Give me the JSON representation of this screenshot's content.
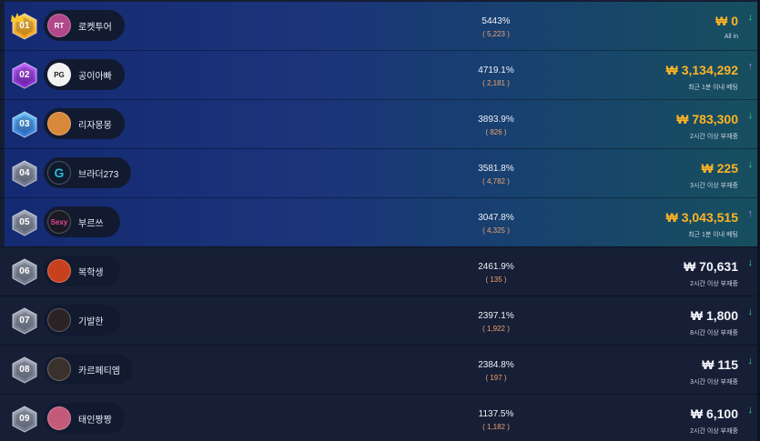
{
  "colors": {
    "gold_amount": "#ffb424",
    "white_amount": "#f3f5fa",
    "count_orange": "#f0a36f",
    "arrow_up": "#c47ce8",
    "arrow_down": "#3ad68a",
    "rank_gold": "#f5a623",
    "rank_purple": "#9b3fd6",
    "rank_blue": "#3f8ee8",
    "rank_gray": "#8a94a8"
  },
  "rows": [
    {
      "rank": "01",
      "name": "로켓투어",
      "percent": "5443%",
      "count": "( 5,223 )",
      "amount": "₩ 0",
      "status": "All in",
      "trend": "↓",
      "trend_dir": "down",
      "rank_color": "gold",
      "highlight": true,
      "avatar_icon": "rocket-tour-avatar-icon",
      "avatar_text": "RT",
      "avatar_color": "#b0488a"
    },
    {
      "rank": "02",
      "name": "공이아빠",
      "percent": "4719.1%",
      "count": "( 2,181 )",
      "amount": "₩ 3,134,292",
      "status": "최근 1분 이내 베팅",
      "trend": "↑",
      "trend_dir": "up",
      "rank_color": "purple",
      "highlight": true,
      "avatar_icon": "pg-logo-icon",
      "avatar_text": "PG",
      "avatar_color": "#f2f2f2"
    },
    {
      "rank": "03",
      "name": "리자몽몽",
      "percent": "3893.9%",
      "count": "( 826 )",
      "amount": "₩ 783,300",
      "status": "2시간 이상 부재중",
      "trend": "↓",
      "trend_dir": "down",
      "rank_color": "blue",
      "highlight": true,
      "avatar_icon": "game-avatar-icon",
      "avatar_text": "",
      "avatar_color": "#d9893a"
    },
    {
      "rank": "04",
      "name": "브라더273",
      "percent": "3581.8%",
      "count": "( 4,782 )",
      "amount": "₩ 225",
      "status": "3시간 이상 부재중",
      "trend": "↓",
      "trend_dir": "down",
      "rank_color": "gray",
      "highlight": true,
      "avatar_icon": "g-logo-icon",
      "avatar_text": "G",
      "avatar_color": "#0f1a2c"
    },
    {
      "rank": "05",
      "name": "부르쓰",
      "percent": "3047.8%",
      "count": "( 4,325 )",
      "amount": "₩ 3,043,515",
      "status": "최근 1분 이내 베팅",
      "trend": "↑",
      "trend_dir": "up",
      "rank_color": "gray",
      "highlight": true,
      "avatar_icon": "sexy-logo-icon",
      "avatar_text": "Sexy",
      "avatar_color": "#1a1a22"
    },
    {
      "rank": "06",
      "name": "복학생",
      "percent": "2461.9%",
      "count": "( 135 )",
      "amount": "₩ 70,631",
      "status": "2시간 이상 부재중",
      "trend": "↓",
      "trend_dir": "down",
      "rank_color": "gray",
      "highlight": false,
      "avatar_icon": "slot-game-avatar-icon",
      "avatar_text": "",
      "avatar_color": "#c8401e"
    },
    {
      "rank": "07",
      "name": "기발한",
      "percent": "2397.1%",
      "count": "( 1,922 )",
      "amount": "₩ 1,800",
      "status": "8시간 이상 부재중",
      "trend": "↓",
      "trend_dir": "down",
      "rank_color": "gray",
      "highlight": false,
      "avatar_icon": "character-avatar-icon",
      "avatar_text": "",
      "avatar_color": "#2a2326"
    },
    {
      "rank": "08",
      "name": "카르페티엠",
      "percent": "2384.8%",
      "count": "( 197 )",
      "amount": "₩ 115",
      "status": "3시간 이상 부재중",
      "trend": "↓",
      "trend_dir": "down",
      "rank_color": "gray",
      "highlight": false,
      "avatar_icon": "character-avatar-icon",
      "avatar_text": "",
      "avatar_color": "#3a302c"
    },
    {
      "rank": "09",
      "name": "태인짱짱",
      "percent": "1137.5%",
      "count": "( 1,182 )",
      "amount": "₩ 6,100",
      "status": "2시간 이상 부재중",
      "trend": "↓",
      "trend_dir": "down",
      "rank_color": "gray",
      "highlight": false,
      "avatar_icon": "game-avatar-icon",
      "avatar_text": "",
      "avatar_color": "#c45a7a"
    }
  ]
}
